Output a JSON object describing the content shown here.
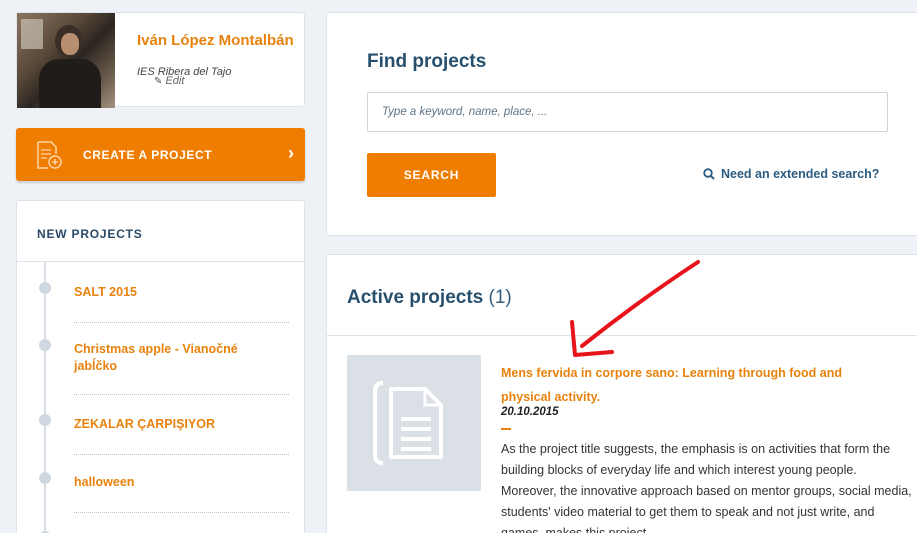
{
  "user": {
    "name": "Iván López Montalbán",
    "school": "IES Ribera del Tajo",
    "edit_label": "Edit"
  },
  "create": {
    "label": "CREATE A PROJECT"
  },
  "new_projects": {
    "heading": "NEW PROJECTS",
    "items": [
      {
        "title": "SALT 2015"
      },
      {
        "title": "Christmas apple - Vianočné jabĺčko"
      },
      {
        "title": "ZEKALAR ÇARPIŞIYOR"
      },
      {
        "title": "halloween"
      }
    ]
  },
  "find": {
    "title": "Find projects",
    "placeholder": "Type a keyword, name, place, ...",
    "search_label": "SEARCH",
    "extended_label": "Need an extended search?"
  },
  "active": {
    "heading": "Active projects",
    "count": "(1)",
    "project": {
      "title": "Mens fervida in corpore sano: Learning through food and physical activity.",
      "date": "20.10.2015",
      "description": "As the project title suggests, the emphasis is on activities that form the building blocks of everyday life and which interest young people. Moreover, the innovative approach based on mentor groups, social media, students' video material to get them to speak and not just write, and games, makes this project..."
    }
  },
  "colors": {
    "accent": "#ef7d00",
    "heading": "#27506f",
    "annotation_arrow": "#e8141c"
  }
}
